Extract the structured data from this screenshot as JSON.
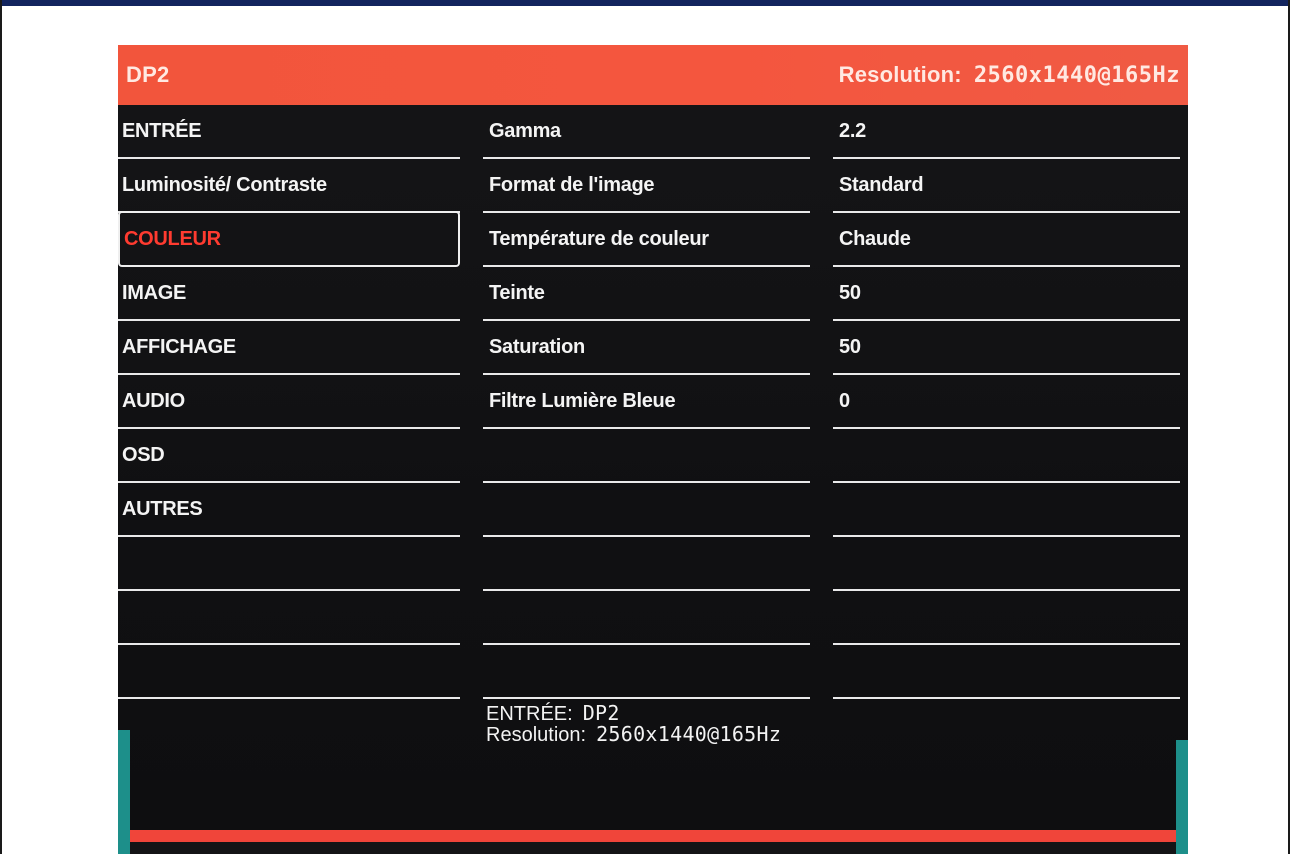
{
  "header": {
    "input_name": "DP2",
    "resolution_label": "Resolution:",
    "resolution_value": "2560x1440@165Hz"
  },
  "menu": {
    "items": [
      {
        "label": "ENTRÉE",
        "selected": false
      },
      {
        "label": "Luminosité/ Contraste",
        "selected": false
      },
      {
        "label": "COULEUR",
        "selected": true
      },
      {
        "label": "IMAGE",
        "selected": false
      },
      {
        "label": "AFFICHAGE",
        "selected": false
      },
      {
        "label": "AUDIO",
        "selected": false
      },
      {
        "label": "OSD",
        "selected": false
      },
      {
        "label": "AUTRES",
        "selected": false
      },
      {
        "label": "",
        "selected": false
      },
      {
        "label": "",
        "selected": false
      },
      {
        "label": "",
        "selected": false
      }
    ]
  },
  "settings": {
    "items": [
      {
        "label": "Gamma",
        "value": "2.2"
      },
      {
        "label": "Format de l'image",
        "value": "Standard"
      },
      {
        "label": "Température de couleur",
        "value": "Chaude"
      },
      {
        "label": "Teinte",
        "value": "50"
      },
      {
        "label": "Saturation",
        "value": "50"
      },
      {
        "label": "Filtre Lumière Bleue",
        "value": "0"
      },
      {
        "label": "",
        "value": ""
      },
      {
        "label": "",
        "value": ""
      },
      {
        "label": "",
        "value": ""
      },
      {
        "label": "",
        "value": ""
      },
      {
        "label": "",
        "value": ""
      }
    ]
  },
  "info": {
    "input_label": "ENTRÉE:",
    "input_value": "DP2",
    "resolution_label": "Resolution:",
    "resolution_value": "2560x1440@165Hz"
  },
  "colors": {
    "header": "#f4563e",
    "selected_text": "#ff3b30",
    "background": "#111113",
    "text": "#f4f4f4",
    "divider": "#e9e9ea"
  }
}
